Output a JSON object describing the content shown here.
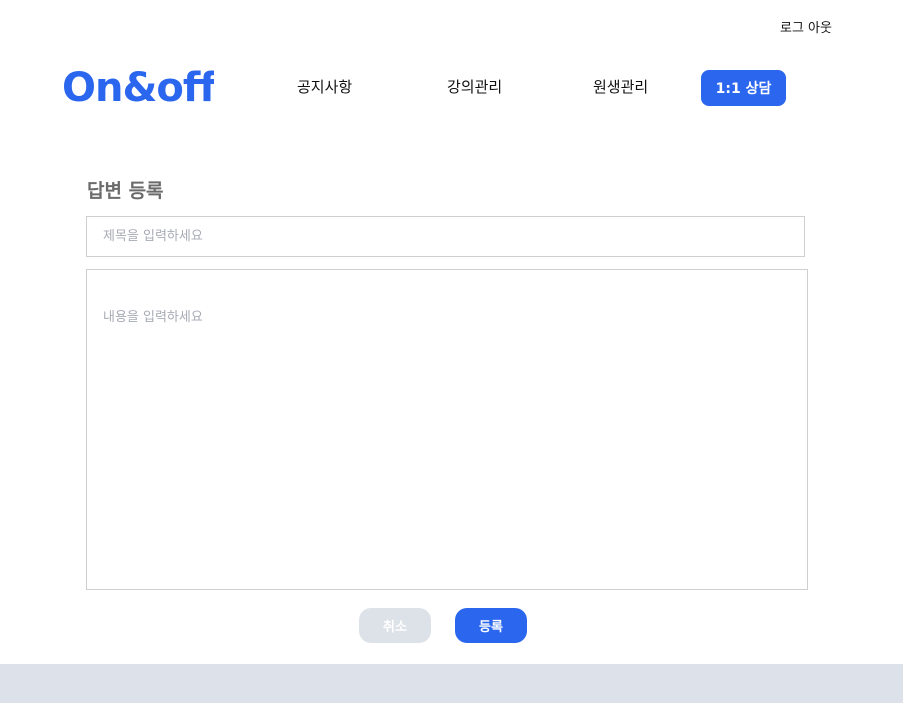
{
  "header": {
    "logout_label": "로그 아웃",
    "logo_text": "On&off",
    "nav": {
      "notice": "공지사항",
      "lectures": "강의관리",
      "students": "원생관리",
      "consult": "1:1 상담"
    }
  },
  "form": {
    "heading": "답변 등록",
    "title_placeholder": "제목을 입력하세요",
    "title_value": "",
    "content_placeholder": "내용을 입력하세요",
    "content_value": "",
    "cancel_label": "취소",
    "submit_label": "등록"
  },
  "colors": {
    "accent": "#2b67ee",
    "cancel_button": "#dde2e9",
    "footer": "#dde2ea"
  }
}
